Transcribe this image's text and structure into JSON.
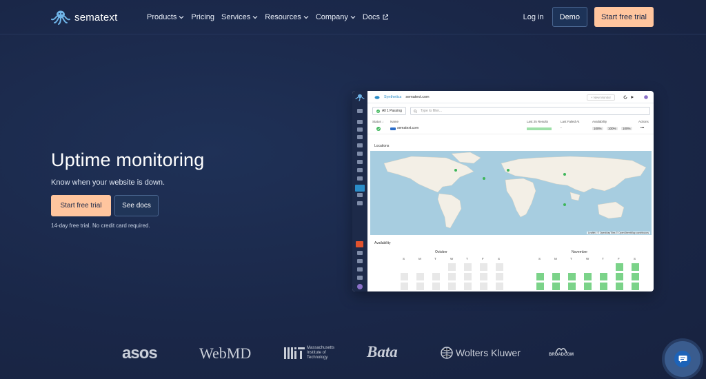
{
  "brand": {
    "name": "sematext"
  },
  "nav": {
    "items": [
      {
        "label": "Products",
        "dropdown": true
      },
      {
        "label": "Pricing",
        "dropdown": false
      },
      {
        "label": "Services",
        "dropdown": true
      },
      {
        "label": "Resources",
        "dropdown": true
      },
      {
        "label": "Company",
        "dropdown": true
      },
      {
        "label": "Docs",
        "external": true
      }
    ],
    "login": "Log in",
    "demo": "Demo",
    "trial": "Start free trial"
  },
  "hero": {
    "title": "Uptime monitoring",
    "subtitle": "Know when your website is down.",
    "primary_cta": "Start free trial",
    "secondary_cta": "See docs",
    "note": "14-day free trial. No credit card required."
  },
  "app": {
    "breadcrumb_app": "Synthetics",
    "breadcrumb_site": "sematext.com",
    "new_monitor": "+ New Monitor",
    "passing_filter": "All 1 Passing",
    "filter_placeholder": "Type to filter...",
    "columns": {
      "status": "Status ↓",
      "name": "Name",
      "last_results": "Last 25 Results",
      "last_failed": "Last Failed At",
      "availability": "Availability",
      "actions": "Actions"
    },
    "row": {
      "name": "sematext.com",
      "last_failed": "-",
      "avail": [
        "100%",
        "100%",
        "100%"
      ],
      "actions": "•••"
    },
    "locations_label": "Locations",
    "map_attribution": "Leaflet | © OpenMapTiles © OpenStreetMap contributors",
    "availability_label": "Availability",
    "months": [
      "October",
      "November"
    ],
    "days": [
      "S",
      "M",
      "T",
      "W",
      "T",
      "F",
      "S"
    ]
  },
  "customers": [
    "asos",
    "WebMD",
    "Massachusetts Institute of Technology",
    "Bata",
    "Wolters Kluwer",
    "BROADCOM"
  ],
  "colors": {
    "accent": "#ffc59e",
    "bg": "#1b2a4d",
    "green": "#7bd389"
  }
}
